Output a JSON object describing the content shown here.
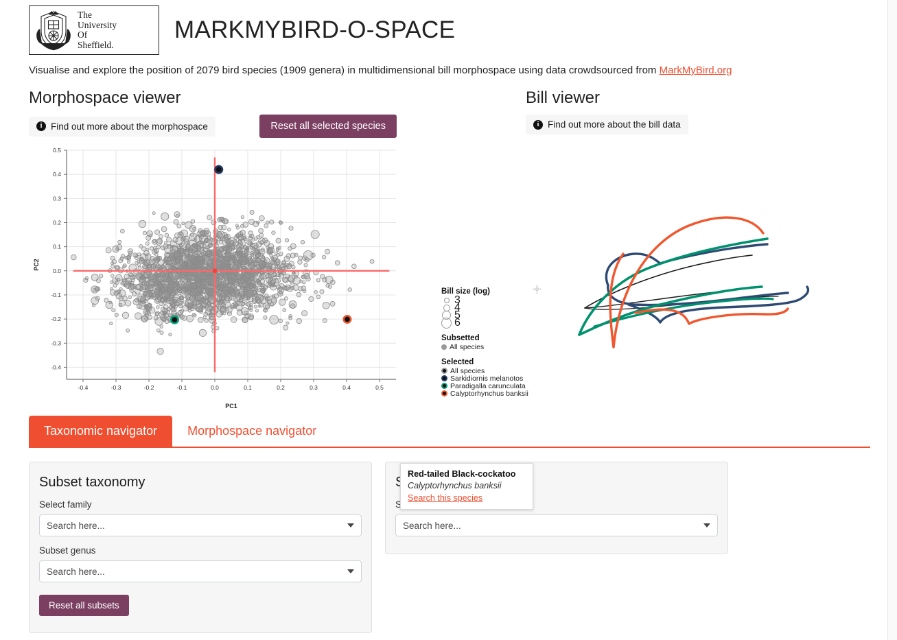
{
  "header": {
    "logo_lines": [
      "The",
      "University",
      "Of",
      "Sheffield."
    ],
    "logo_alt": "university-of-sheffield-crest",
    "app_title": "MARKMYBIRD-O-SPACE",
    "subtitle_before": "Visualise and explore the position of 2079 bird species (1909 genera) in multidimensional bill morphospace using data crowdsourced from ",
    "subtitle_link": "MarkMyBird.org"
  },
  "morphospace": {
    "title": "Morphospace viewer",
    "info_button": "Find out more about the morphospace",
    "info_glyph": "i",
    "reset_button": "Reset all selected species",
    "gear_icon": "gear-icon"
  },
  "bill_viewer": {
    "title": "Bill viewer",
    "info_button": "Find out more about the bill data",
    "info_glyph": "i",
    "curve_colors": [
      "#1a1a1a",
      "#2e4a73",
      "#00916e",
      "#f0572e"
    ]
  },
  "legend": {
    "size_title": "Bill size (log)",
    "size_values": [
      "3",
      "4",
      "5",
      "6"
    ],
    "size_radii": [
      3,
      4,
      5.5,
      7
    ],
    "subsetted_title": "Subsetted",
    "subsetted_items": [
      {
        "label": "All species",
        "color": "#999999"
      }
    ],
    "selected_title": "Selected",
    "selected_items": [
      {
        "label": "All species",
        "color": "#9b9b9b"
      },
      {
        "label": "Sarkidiornis melanotos",
        "color": "#1f3864"
      },
      {
        "label": "Paradigalla carunculata",
        "color": "#00a07a"
      },
      {
        "label": "Calyptorhynchus banksii",
        "color": "#f0572e"
      }
    ]
  },
  "tooltip": {
    "common_name": "Red-tailed Black-cockatoo",
    "scientific_name": "Calyptorhynchus banksii",
    "link": "Search this species"
  },
  "tabs": [
    {
      "label": "Taxonomic navigator",
      "active": true
    },
    {
      "label": "Morphospace navigator",
      "active": false
    }
  ],
  "subset_card": {
    "title": "Subset taxonomy",
    "family_label": "Select family",
    "family_placeholder": "Search here...",
    "genus_label": "Subset genus",
    "genus_placeholder": "Search here...",
    "reset_button": "Reset all subsets"
  },
  "species_card": {
    "title": "Select species",
    "field_label": "Select species",
    "placeholder": "Search here..."
  },
  "colors": {
    "accent_orange": "#f04e30",
    "accent_purple": "#7b3f62",
    "crosshair_red": "#fb6a6a",
    "point_gray": "#8a8a8a"
  },
  "chart_data": {
    "type": "scatter",
    "title": "",
    "xlabel": "PC1",
    "ylabel": "PC2",
    "xlim": [
      -0.45,
      0.55
    ],
    "ylim": [
      -0.45,
      0.5
    ],
    "xticks": [
      -0.4,
      -0.3,
      -0.2,
      -0.1,
      0.0,
      0.1,
      0.2,
      0.3,
      0.4,
      0.5
    ],
    "yticks": [
      -0.4,
      -0.3,
      -0.2,
      -0.1,
      0.0,
      0.1,
      0.2,
      0.3,
      0.4,
      0.5
    ],
    "grid": true,
    "legend_position": "right",
    "n_points": 2079,
    "point_color": "#8a8a8a",
    "crosshair": {
      "x": 0.0,
      "y": 0.0,
      "color": "#fb6a6a"
    },
    "highlighted": [
      {
        "name": "Sarkidiornis melanotos",
        "x": 0.012,
        "y": 0.42,
        "color": "#1f3864"
      },
      {
        "name": "Paradigalla carunculata",
        "x": -0.122,
        "y": -0.203,
        "color": "#00a07a"
      },
      {
        "name": "Calyptorhynchus banksii",
        "x": 0.402,
        "y": -0.201,
        "color": "#f0572e"
      }
    ],
    "cloud": {
      "center_x": -0.02,
      "center_y": -0.01,
      "spread_x": 0.13,
      "spread_y": 0.085
    }
  }
}
